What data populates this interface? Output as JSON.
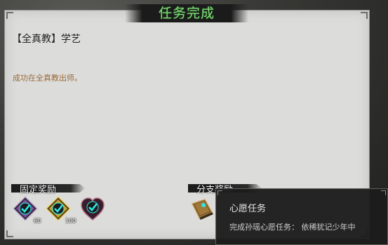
{
  "dialog": {
    "title": "任务完成",
    "quest_name": "【全真教】学艺",
    "description": "成功在全真教出师。"
  },
  "fixed_rewards": {
    "label": "固定奖励",
    "items": [
      {
        "icon": "purple-diamond-check-icon",
        "count": "60"
      },
      {
        "icon": "gold-diamond-check-icon",
        "count": "100"
      },
      {
        "icon": "dark-heart-check-icon",
        "count": ""
      }
    ]
  },
  "branch_rewards": {
    "label": "分支奖励",
    "items": [
      {
        "icon": "book-icon"
      }
    ]
  },
  "tooltip": {
    "title": "心愿任务",
    "body": "完成孙瑶心愿任务：  依稀犹记少年中"
  },
  "colors": {
    "title_green": "#7fe07a",
    "description_brown": "#9b6b3d",
    "check_cyan": "#2ee6e6"
  }
}
